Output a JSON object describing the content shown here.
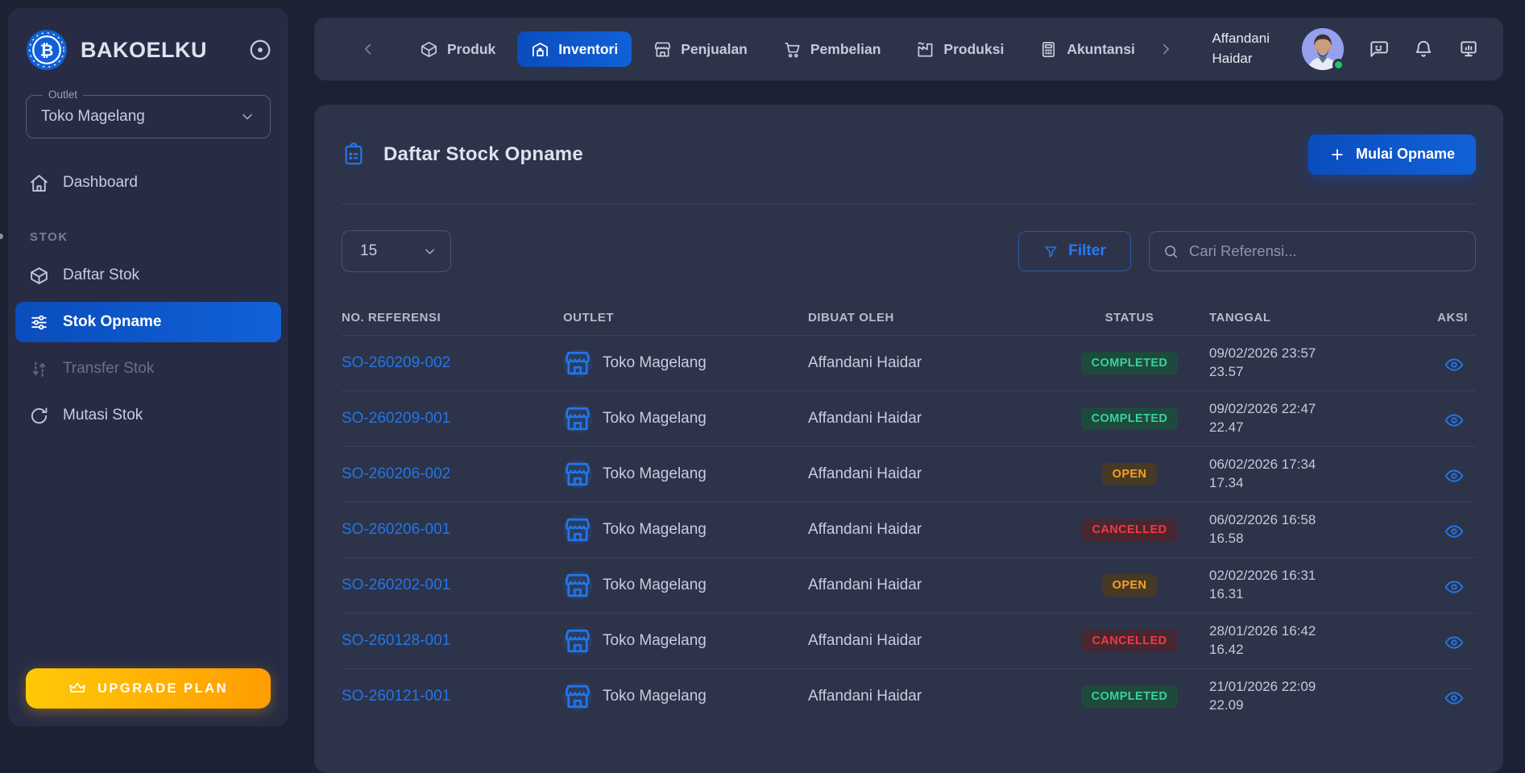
{
  "brand": {
    "name": "BAKOELKU"
  },
  "sidebar": {
    "outlet": {
      "label": "Outlet",
      "value": "Toko Magelang"
    },
    "section_label": "STOK",
    "items": [
      {
        "label": "Dashboard"
      },
      {
        "label": "Daftar Stok"
      },
      {
        "label": "Stok Opname"
      },
      {
        "label": "Transfer Stok"
      },
      {
        "label": "Mutasi Stok"
      }
    ],
    "upgrade_label": "UPGRADE PLAN"
  },
  "topnav": {
    "items": [
      {
        "label": "Produk"
      },
      {
        "label": "Inventori"
      },
      {
        "label": "Penjualan"
      },
      {
        "label": "Pembelian"
      },
      {
        "label": "Produksi"
      },
      {
        "label": "Akuntansi"
      }
    ],
    "user": {
      "first_name": "Affandani",
      "last_name": "Haidar"
    }
  },
  "page": {
    "title": "Daftar Stock Opname",
    "primary_action_label": "Mulai Opname",
    "page_size_value": "15",
    "filter_label": "Filter",
    "search_placeholder": "Cari Referensi..."
  },
  "table": {
    "columns": [
      "NO. REFERENSI",
      "OUTLET",
      "DIBUAT OLEH",
      "STATUS",
      "TANGGAL",
      "AKSI"
    ],
    "rows": [
      {
        "ref": "SO-260209-002",
        "outlet": "Toko Magelang",
        "created_by": "Affandani Haidar",
        "status": "COMPLETED",
        "date": "09/02/2026 23:57",
        "time": "23.57"
      },
      {
        "ref": "SO-260209-001",
        "outlet": "Toko Magelang",
        "created_by": "Affandani Haidar",
        "status": "COMPLETED",
        "date": "09/02/2026 22:47",
        "time": "22.47"
      },
      {
        "ref": "SO-260206-002",
        "outlet": "Toko Magelang",
        "created_by": "Affandani Haidar",
        "status": "OPEN",
        "date": "06/02/2026 17:34",
        "time": "17.34"
      },
      {
        "ref": "SO-260206-001",
        "outlet": "Toko Magelang",
        "created_by": "Affandani Haidar",
        "status": "CANCELLED",
        "date": "06/02/2026 16:58",
        "time": "16.58"
      },
      {
        "ref": "SO-260202-001",
        "outlet": "Toko Magelang",
        "created_by": "Affandani Haidar",
        "status": "OPEN",
        "date": "02/02/2026 16:31",
        "time": "16.31"
      },
      {
        "ref": "SO-260128-001",
        "outlet": "Toko Magelang",
        "created_by": "Affandani Haidar",
        "status": "CANCELLED",
        "date": "28/01/2026 16:42",
        "time": "16.42"
      },
      {
        "ref": "SO-260121-001",
        "outlet": "Toko Magelang",
        "created_by": "Affandani Haidar",
        "status": "COMPLETED",
        "date": "21/01/2026 22:09",
        "time": "22.09"
      }
    ]
  },
  "colors": {
    "accent_blue": "#1161d8",
    "link_blue": "#2276e9",
    "status_completed": "#36d39a",
    "status_open": "#f6a21e",
    "status_cancelled": "#f4393f",
    "upgrade_start": "#ffc907",
    "upgrade_end": "#ff9d00"
  }
}
